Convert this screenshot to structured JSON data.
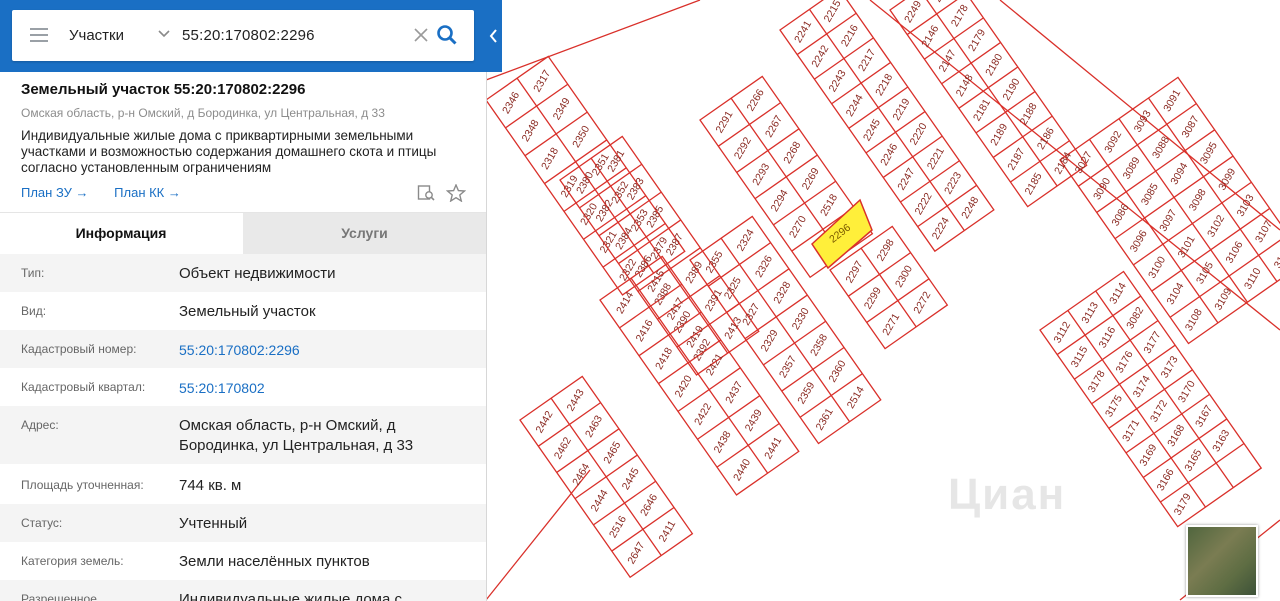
{
  "search": {
    "type_label": "Участки",
    "query": "55:20:170802:2296"
  },
  "object": {
    "title": "Земельный участок 55:20:170802:2296",
    "address_short": "Омская область, р-н Омский, д Бородинка, ул Центральная, д 33",
    "description": "Индивидуальные жилые дома с приквартирными земельными участками и возможностью содержания домашнего скота и птицы согласно установленным ограничениям",
    "link_zu": "План ЗУ →",
    "link_kk": "План КК →"
  },
  "tabs": {
    "info": "Информация",
    "services": "Услуги"
  },
  "info": [
    {
      "label": "Тип:",
      "value": "Объект недвижимости"
    },
    {
      "label": "Вид:",
      "value": "Земельный участок"
    },
    {
      "label": "Кадастровый номер:",
      "value": "55:20:170802:2296"
    },
    {
      "label": "Кадастровый квартал:",
      "value": "55:20:170802"
    },
    {
      "label": "Адрес:",
      "value": "Омская область, р-н Омский, д Бородинка, ул Центральная, д 33"
    },
    {
      "label": "Площадь уточненная:",
      "value": "744 кв. м"
    },
    {
      "label": "Статус:",
      "value": "Учтенный"
    },
    {
      "label": "Категория земель:",
      "value": "Земли населённых пунктов"
    },
    {
      "label": "Разрешенное",
      "value": "Индивидуальные жилые дома с"
    }
  ],
  "map": {
    "selected_parcel": "2296",
    "colors": {
      "line": "#d9302a",
      "selected": "#ffef3a",
      "label": "#8a2a22",
      "accent": "#1a6fc4"
    },
    "labels_left_block": [
      "2346",
      "2317",
      "2348",
      "2349",
      "2318",
      "2350",
      "2319",
      "2351",
      "2320",
      "2352",
      "2321",
      "2353",
      "2322",
      "2379",
      "2380",
      "2381",
      "2382",
      "2383",
      "2384",
      "2385",
      "2386",
      "2387",
      "2388",
      "2389",
      "2390",
      "2391",
      "2392",
      "2413",
      "2414",
      "2415",
      "2416",
      "2417",
      "2418",
      "2419",
      "2420",
      "2421",
      "2422",
      "2437",
      "2438",
      "2439",
      "2440",
      "2441",
      "2442",
      "2443",
      "2462",
      "2463",
      "2464",
      "2465",
      "2444",
      "2445",
      "2516",
      "2646",
      "2647",
      "2411",
      "2410",
      "2378"
    ],
    "labels_mid_block": [
      "2291",
      "2266",
      "2292",
      "2267",
      "2293",
      "2268",
      "2294",
      "2269",
      "2270",
      "2518",
      "2355",
      "2324",
      "2325",
      "2326",
      "2327",
      "2328",
      "2329",
      "2330",
      "2357",
      "2358",
      "2359",
      "2360",
      "2361",
      "2514",
      "2297",
      "2298",
      "2299",
      "2300",
      "2271",
      "2272"
    ],
    "labels_top_block": [
      "2241",
      "2215",
      "2242",
      "2216",
      "2243",
      "2217",
      "2244",
      "2218",
      "2245",
      "2219",
      "2246",
      "2220",
      "2247",
      "2221",
      "2222",
      "2223",
      "2224",
      "2248",
      "2249",
      "2177",
      "2146",
      "2178",
      "2147",
      "2179",
      "2148",
      "2180",
      "2181",
      "2190",
      "2189",
      "2188",
      "2187",
      "2186",
      "2185",
      "2184"
    ],
    "labels_right_block": [
      "3027",
      "3092",
      "3093",
      "3091",
      "3090",
      "3089",
      "3088",
      "3087",
      "3086",
      "3085",
      "3094",
      "3095",
      "3096",
      "3097",
      "3098",
      "3099",
      "3100",
      "3101",
      "3102",
      "3103",
      "3104",
      "3105",
      "3106",
      "3107",
      "3108",
      "3109",
      "3110",
      "3111",
      "3112",
      "3113",
      "3114",
      "3115",
      "3116",
      "3082",
      "3178",
      "3176",
      "3177",
      "3175",
      "3174",
      "3173",
      "3171",
      "3172",
      "3170",
      "3169",
      "3168",
      "3167",
      "3166",
      "3165",
      "3163",
      "3179"
    ]
  },
  "watermark": "Циан"
}
